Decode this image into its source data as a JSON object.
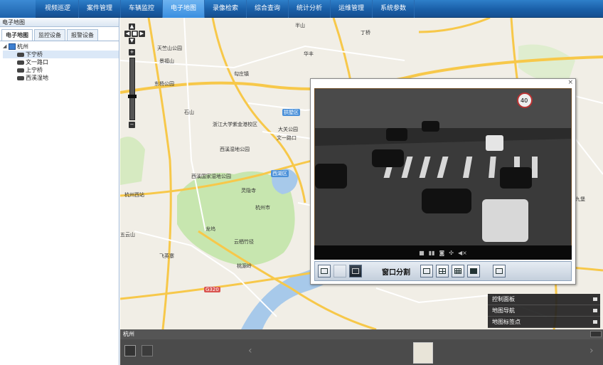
{
  "nav": {
    "items": [
      "视频巡逻",
      "案件管理",
      "车辆监控",
      "电子地图",
      "录像检索",
      "综合查询",
      "统计分析",
      "运维管理",
      "系统参数"
    ],
    "active_index": 3
  },
  "left_panel": {
    "title": "电子地图",
    "tabs": [
      "电子地图",
      "监控设备",
      "报警设备"
    ],
    "tree": {
      "root": "杭州",
      "children": [
        "下宁桥",
        "文一路口",
        "上宁桥",
        "西溪湿地"
      ]
    }
  },
  "map": {
    "labels": {
      "l1": "天竺山公园",
      "l2": "景福山",
      "l3": "勾庄镇",
      "l4": "东杨公园",
      "l5": "石山",
      "l6": "浙江大学紫金港校区",
      "l7": "大关公园",
      "l8": "拱墅区",
      "l9": "西溪湿地公园",
      "l10": "西湖区",
      "l11": "西溪国家湿地公园",
      "l12": "杭州西站",
      "l13": "灵隐寺",
      "l14": "龙坞",
      "l15": "云栖竹径",
      "l16": "五云山",
      "l17": "桃源岭",
      "l18": "飞英寨",
      "l19": "杭州市",
      "l20": "文一路口",
      "l21": "半山",
      "l22": "丁桥",
      "l23": "华丰",
      "l24": "九堡"
    },
    "badges": {
      "b1": "拱墅区",
      "b2": "西湖区",
      "b3": "G320"
    }
  },
  "popup": {
    "close": "×",
    "split_label": "窗口分割",
    "video_controls": [
      "■",
      "▮▮",
      "◙",
      "✣",
      "◀×"
    ]
  },
  "layers": [
    "控制面板",
    "地图导航",
    "地图标签点"
  ],
  "bottom": {
    "title": "杭州"
  },
  "colors": {
    "nav_bg": "#1a5fa8",
    "nav_active": "#4a9ae6",
    "major_road": "#f7c84a",
    "water": "#a7c9ea",
    "green": "#bde3a1"
  }
}
